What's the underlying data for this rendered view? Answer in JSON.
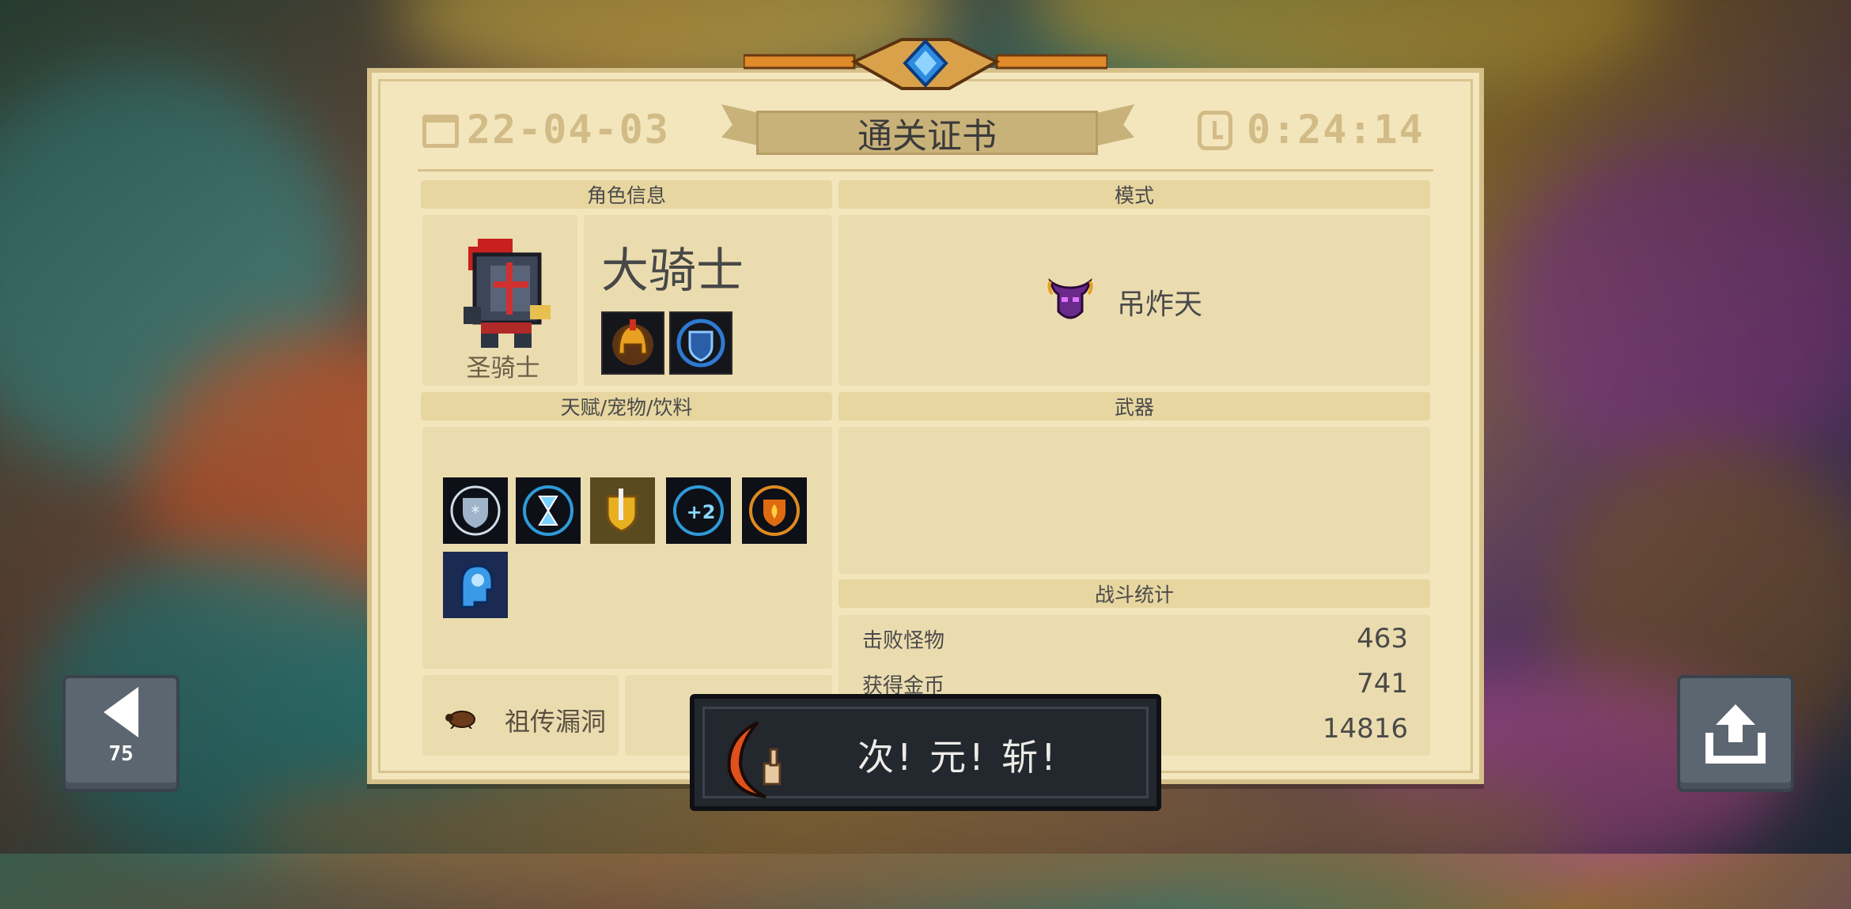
{
  "header": {
    "date": "22-04-03",
    "title": "通关证书",
    "time": "0:24:14"
  },
  "sections": {
    "character": "角色信息",
    "mode": "模式",
    "talents": "天赋/宠物/饮料",
    "weapon": "武器",
    "combat": "战斗统计"
  },
  "character": {
    "class_name": "大骑士",
    "skin_name": "圣骑士",
    "skills": [
      "golden-helmet-icon",
      "blue-shield-skill-icon"
    ]
  },
  "mode": {
    "name": "吊炸天",
    "icon": "purple-demon-helmet-icon"
  },
  "talents": [
    "frost-shield-icon",
    "hourglass-icon",
    "golden-shield-icon",
    "plus-two-icon",
    "fire-shield-icon",
    "blue-brain-icon"
  ],
  "pet": {
    "name": "祖传漏洞",
    "icon": "bug-icon"
  },
  "stats": [
    {
      "label": "击败怪物",
      "value": "463"
    },
    {
      "label": "获得金币",
      "value": "741"
    },
    {
      "label": "",
      "value": "14816"
    }
  ],
  "nav": {
    "back_number": "75"
  },
  "toast": {
    "text": "次! 元! 斩!",
    "icon": "crescent-blade-icon"
  },
  "colors": {
    "card_bg": "#f3e6bd",
    "panel": "#ebdcaf",
    "header_strip": "#e7d6a0",
    "toast_bg": "#23272e"
  }
}
